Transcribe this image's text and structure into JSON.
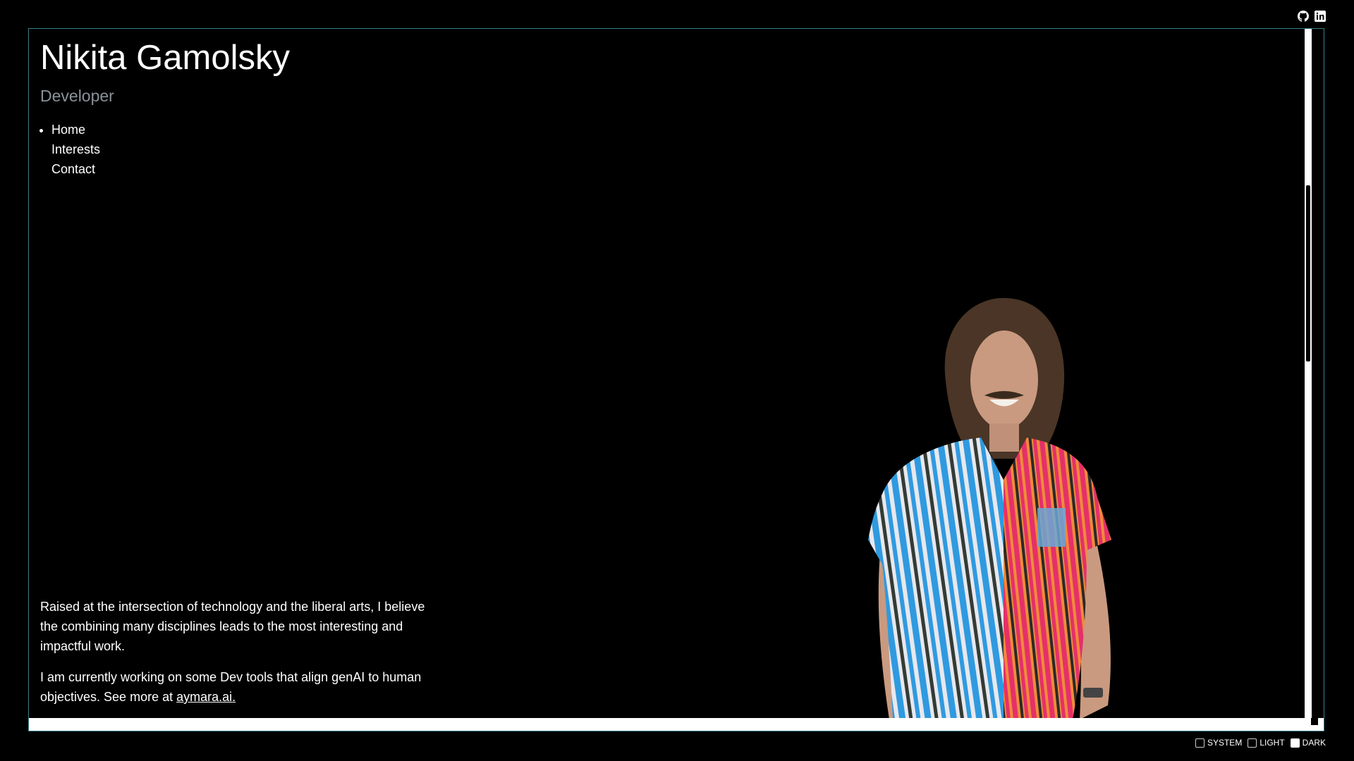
{
  "header": {
    "social": [
      {
        "icon": "github-icon"
      },
      {
        "icon": "linkedin-icon"
      }
    ]
  },
  "profile": {
    "name": "Nikita Gamolsky",
    "role": "Developer"
  },
  "nav": {
    "items": [
      {
        "label": "Home",
        "active": true
      },
      {
        "label": "Interests",
        "active": false
      },
      {
        "label": "Contact",
        "active": false
      }
    ]
  },
  "bio": {
    "paragraph1": "Raised at the intersection of technology and the liberal arts, I believe the combining many disciplines leads to the most interesting and impactful work.",
    "paragraph2_prefix": "I am currently working on some Dev tools that align genAI to human objectives. See more at ",
    "link_text": "aymara.ai."
  },
  "theme": {
    "options": [
      {
        "label": "SYSTEM",
        "checked": false
      },
      {
        "label": "LIGHT",
        "checked": false
      },
      {
        "label": "DARK",
        "checked": true
      }
    ]
  },
  "colors": {
    "background": "#000000",
    "frame_border": "#3a7f8c",
    "subtitle": "#8a929a",
    "text": "#ffffff"
  }
}
